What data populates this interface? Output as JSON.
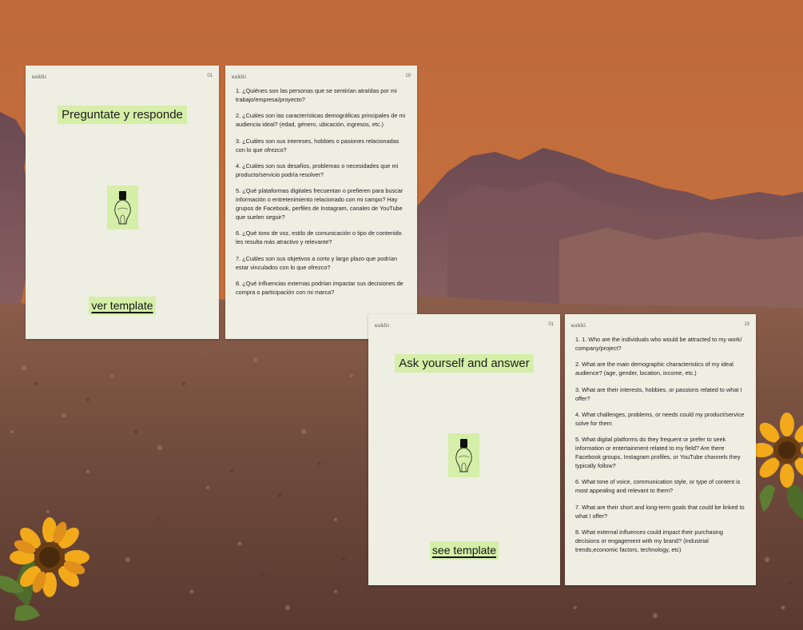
{
  "colors": {
    "sky": "#c46c3d",
    "card": "#efeee3",
    "highlight": "#d5efa8",
    "text": "#222222"
  },
  "icons": [
    "lightbulb-icon",
    "sunflower-icon"
  ],
  "spanish": {
    "cover": {
      "brand": "ĸukhi",
      "page": "01",
      "title": "Preguntate y responde",
      "link": "ver template"
    },
    "questions_page": {
      "brand": "ĸukhi",
      "page": "19",
      "items": [
        "1. ¿Quiénes son las personas que se sentirían atraídas por mi trabajo/empresa/proyecto?",
        "2. ¿Cuáles son las características demográficas principales de mi audiencia ideal? (edad, género, ubicación, ingresos, etc.)",
        "3. ¿Cuáles son sus intereses, hobbies o pasiones relacionadas con lo que ofrezco?",
        "4. ¿Cuáles son sus desafíos, problemas o necesidades que mi producto/servicio podría resolver?",
        "5. ¿Qué plataformas digitales frecuentan o prefieren para buscar información o entretenimiento relacionado con mi campo? Hay grupos de Facebook, perfiles de Instagram, canales de YouTube que suelen seguir?",
        "6. ¿Qué tono de voz, estilo de comunicación o tipo de contenido les resulta más atractivo y relevante?",
        "7. ¿Cuáles son sus objetivos a corto y largo plazo que podrían estar vinculados con lo que ofrezco?",
        "8. ¿Qué influencias externas podrían impactar sus decisiones de compra o participación con mi marca?"
      ]
    }
  },
  "english": {
    "cover": {
      "brand": "ĸukhi",
      "page": "01",
      "title": "Ask yourself and answer",
      "link": "see template"
    },
    "questions_page": {
      "brand": "ĸukhi",
      "page": "19",
      "items": [
        "1. 1. Who are the individuals who would be attracted to my work/ company/project?",
        "2. What are the main demographic characteristics of my ideal audience? (age, gender, location, income, etc.)",
        "3. What are their interests, hobbies, or passions related to what I offer?",
        "4. What challenges, problems, or needs could my product/service solve for them",
        "5. What digital platforms do they frequent or prefer to seek information or entertainment related to my field? Are there Facebook groups, Instagram profiles, or YouTube channels they typically follow?",
        "6. What tone of voice, communication style, or type of content is most appealing and relevant to them?",
        "7. What are their short and long-term goals that could be linked to what I offer?",
        "8. What external influences could impact their purchasing decisions or engagement with my brand? (industrial trends,economic factors, technology, etc)"
      ]
    }
  }
}
